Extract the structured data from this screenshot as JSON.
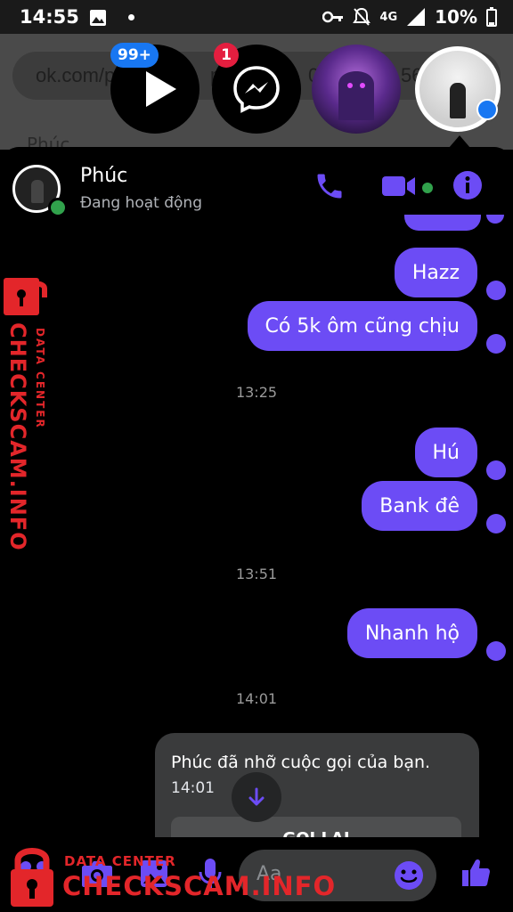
{
  "status_bar": {
    "time": "14:55",
    "network": "4G",
    "battery": "10%"
  },
  "background": {
    "url_fragment": "ok.com/p",
    "url_fragment_2": "p",
    "url_fragment_3": "05",
    "url_fragment_4": "56",
    "title": "Phúc"
  },
  "chat_heads": {
    "video_badge": "99+",
    "messenger_badge": "1"
  },
  "header": {
    "name": "Phúc",
    "presence": "Đang hoạt động"
  },
  "messages": [
    {
      "text": "Hazz"
    },
    {
      "text": "Có 5k ôm cũng chịu"
    },
    {
      "text": "Hú"
    },
    {
      "text": "Bank đê"
    },
    {
      "text": "Nhanh hộ"
    }
  ],
  "timestamps": [
    "13:25",
    "13:51",
    "14:01"
  ],
  "missed_call": {
    "text": "Phúc đã nhỡ cuộc gọi của bạn.",
    "time": "14:01",
    "button": "GỌI LẠI"
  },
  "composer": {
    "placeholder": "Aa"
  },
  "watermark": {
    "side_big": "CHECKSCAM.INFO",
    "side_small": "DATA CENTER",
    "bottom_small": "DATA CENTER",
    "bottom_big": "CHECKSCAM.INFO"
  },
  "colors": {
    "accent": "#6c4cf5",
    "online": "#31a24c",
    "watermark": "#e3262a"
  }
}
